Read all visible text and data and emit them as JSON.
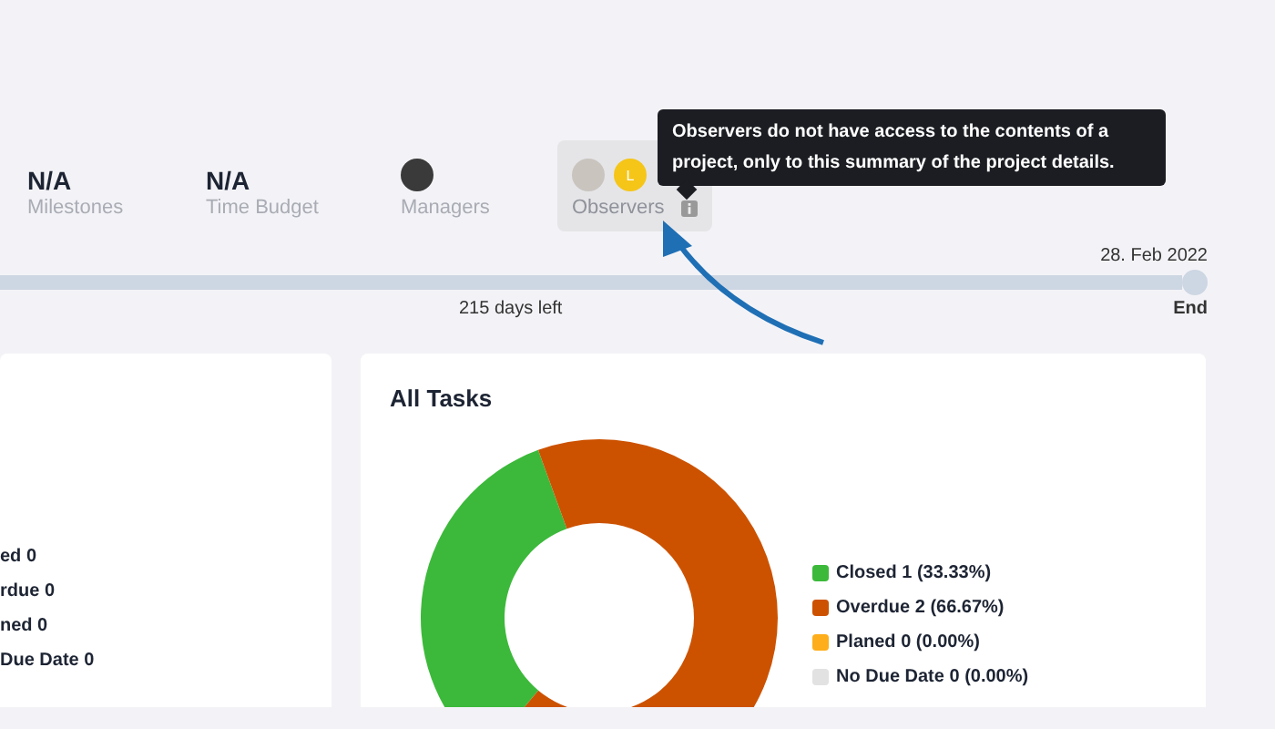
{
  "stats": [
    {
      "kind": "value",
      "value": "N/A",
      "label": "Milestones"
    },
    {
      "kind": "value",
      "value": "N/A",
      "label": "Time Budget"
    },
    {
      "kind": "people",
      "label": "Managers",
      "avatars": [
        {
          "kind": "photo"
        }
      ]
    },
    {
      "kind": "people",
      "label": "Observers",
      "highlighted": true,
      "info": true,
      "avatars": [
        {
          "kind": "photo"
        },
        {
          "kind": "initial",
          "initial": "L",
          "color": "#f5c518"
        }
      ]
    }
  ],
  "tooltip": {
    "text": "Observers do not have access to the contents of a project, only to this summary of the project details."
  },
  "timeline": {
    "remaining": "215 days left",
    "end_date": "28. Feb 2022",
    "end_label": "End"
  },
  "left_card": {
    "legend": [
      "ed 0",
      "rdue 0",
      "ned 0",
      "Due Date 0"
    ]
  },
  "all_tasks": {
    "title": "All Tasks",
    "legend": [
      {
        "label": "Closed 1 (33.33%)",
        "color": "#3cb93a"
      },
      {
        "label": "Overdue 2 (66.67%)",
        "color": "#cc5200"
      },
      {
        "label": "Planed 0 (0.00%)",
        "color": "#fdae1a"
      },
      {
        "label": "No Due Date 0 (0.00%)",
        "color": "#e2e2e2"
      }
    ],
    "chart_data": {
      "type": "donut",
      "values": [
        33.33,
        66.67,
        0,
        0
      ]
    }
  }
}
